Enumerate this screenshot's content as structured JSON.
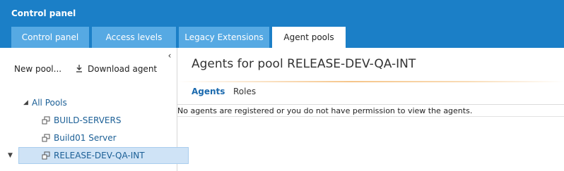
{
  "header": {
    "title": "Control panel",
    "tabs": [
      {
        "label": "Control panel",
        "active": false
      },
      {
        "label": "Access levels",
        "active": false
      },
      {
        "label": "Legacy Extensions",
        "active": false
      },
      {
        "label": "Agent pools",
        "active": true
      }
    ]
  },
  "sidebar": {
    "collapse_icon": "chevron-left-icon",
    "toolbar": {
      "new_pool_label": "New pool...",
      "download_agent_label": "Download agent",
      "download_icon": "download-icon"
    },
    "tree": {
      "root_label": "All Pools",
      "items": [
        {
          "label": "BUILD-SERVERS",
          "icon": "pool-icon",
          "selected": false
        },
        {
          "label": "Build01 Server",
          "icon": "pool-icon",
          "selected": false
        },
        {
          "label": "RELEASE-DEV-QA-INT",
          "icon": "pool-icon",
          "selected": true
        }
      ]
    }
  },
  "main": {
    "title": "Agents for pool RELEASE-DEV-QA-INT",
    "pivots": [
      {
        "label": "Agents",
        "active": true
      },
      {
        "label": "Roles",
        "active": false
      }
    ],
    "empty_message": "No agents are registered or you do not have permission to view the agents."
  },
  "colors": {
    "header_bg": "#1b7fc7",
    "tab_bg": "#56a9e3",
    "accent": "#1b6aae",
    "selection_bg": "#cfe3f6"
  }
}
